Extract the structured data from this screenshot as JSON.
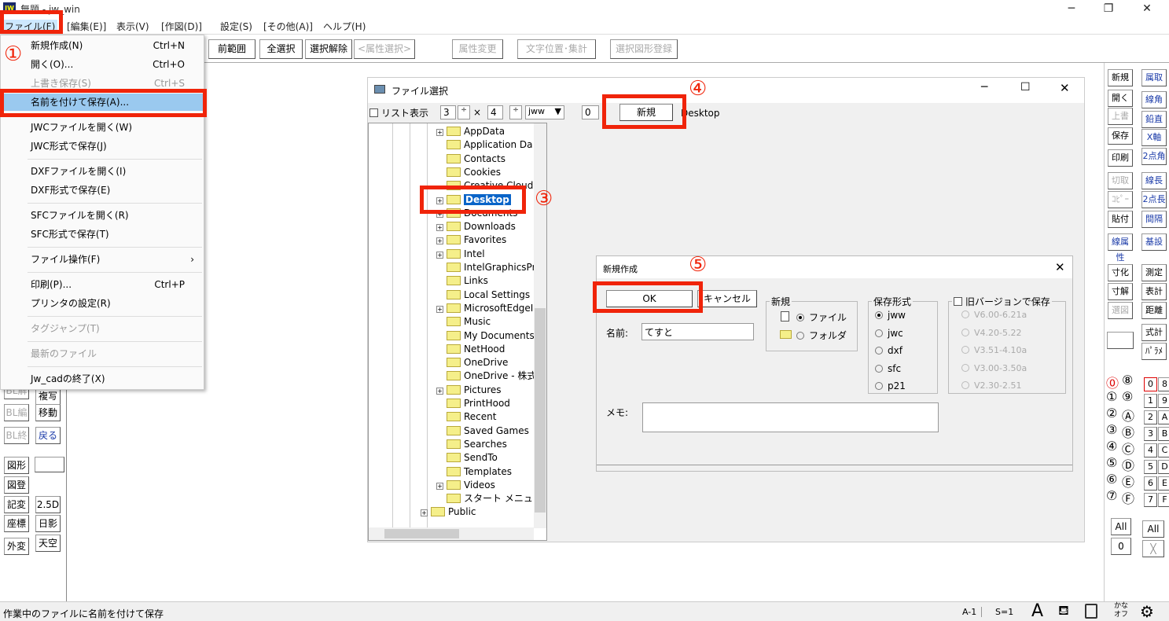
{
  "window": {
    "title": "無題 - jw_win",
    "icon": "JW",
    "minimize": "─",
    "restore": "❐",
    "close": "✕"
  },
  "menubar": [
    "ファイル(F)",
    "[編集(E)]",
    "表示(V)",
    "[作図(D)]",
    "設定(S)",
    "[その他(A)]",
    "ヘルプ(H)"
  ],
  "toolbar": [
    {
      "label": "前範囲",
      "disabled": false
    },
    {
      "label": "全選択",
      "disabled": false
    },
    {
      "label": "選択解除",
      "disabled": false
    },
    {
      "label": "<属性選択>",
      "disabled": true
    },
    {
      "label": "属性変更",
      "disabled": true
    },
    {
      "label": "文字位置･集計",
      "disabled": true
    },
    {
      "label": "選択図形登録",
      "disabled": true
    }
  ],
  "file_menu": [
    {
      "label": "新規作成(N)",
      "shortcut": "Ctrl+N"
    },
    {
      "label": "開く(O)...",
      "shortcut": "Ctrl+O"
    },
    {
      "label": "上書き保存(S)",
      "shortcut": "Ctrl+S",
      "disabled": true
    },
    {
      "label": "名前を付けて保存(A)...",
      "highlighted": true
    },
    {
      "label": "JWCファイルを開く(W)",
      "sep": true
    },
    {
      "label": "JWC形式で保存(J)"
    },
    {
      "label": "DXFファイルを開く(I)",
      "sep": true
    },
    {
      "label": "DXF形式で保存(E)"
    },
    {
      "label": "SFCファイルを開く(R)",
      "sep": true
    },
    {
      "label": "SFC形式で保存(T)"
    },
    {
      "label": "ファイル操作(F)",
      "submenu": true,
      "sep": true
    },
    {
      "label": "印刷(P)...",
      "shortcut": "Ctrl+P",
      "sep": true
    },
    {
      "label": "プリンタの設定(R)"
    },
    {
      "label": "タグジャンプ(T)",
      "disabled": true,
      "sep": true
    },
    {
      "label": "最新のファイル",
      "disabled": true,
      "sep": true
    },
    {
      "label": "Jw_cadの終了(X)",
      "sep": true
    }
  ],
  "left_toolbar": {
    "col1": [
      {
        "label": "BL解",
        "disabled": true
      },
      {
        "label": "BL編",
        "disabled": true
      },
      {
        "label": "BL終",
        "disabled": true
      },
      {
        "label": "図形"
      },
      {
        "label": "図登"
      },
      {
        "label": "記変"
      },
      {
        "label": "座標"
      },
      {
        "label": "外変"
      }
    ],
    "col2": [
      {
        "label": "複写"
      },
      {
        "label": "移動"
      },
      {
        "label": "戻る",
        "blue": true
      },
      {
        "label": "2.5D"
      },
      {
        "label": "日影"
      },
      {
        "label": "天空"
      }
    ]
  },
  "right_toolbar": {
    "col1": [
      {
        "label": "新規"
      },
      {
        "label": "開く"
      },
      {
        "label": "上書",
        "disabled": true
      },
      {
        "label": "保存"
      },
      {
        "label": "印刷"
      },
      {
        "label": "切取",
        "disabled": true
      },
      {
        "label": "ｺﾋﾟｰ",
        "disabled": true
      },
      {
        "label": "貼付"
      },
      {
        "label": "線属性",
        "blue": true
      },
      {
        "label": "寸化"
      },
      {
        "label": "寸解"
      },
      {
        "label": "選図",
        "disabled": true
      }
    ],
    "col2": [
      {
        "label": "属取",
        "blue": true
      },
      {
        "label": "線角",
        "blue": true
      },
      {
        "label": "鉛直",
        "blue": true
      },
      {
        "label": "X軸",
        "blue": true
      },
      {
        "label": "2点角",
        "blue": true
      },
      {
        "label": "線長",
        "blue": true
      },
      {
        "label": "2点長",
        "blue": true
      },
      {
        "label": "間隔",
        "blue": true
      },
      {
        "label": "基設",
        "blue": true
      },
      {
        "label": "測定"
      },
      {
        "label": "表計"
      },
      {
        "label": "距離"
      },
      {
        "label": "式計"
      },
      {
        "label": "ﾊﾟﾗﾒ"
      }
    ],
    "layer_groups": [
      "⓪",
      "⑧",
      "①",
      "⑨",
      "②",
      "Ⓐ",
      "③",
      "Ⓑ",
      "④",
      "Ⓒ",
      "⑤",
      "Ⓓ",
      "⑥",
      "Ⓔ",
      "⑦",
      "Ⓕ"
    ],
    "layers": [
      "0",
      "8",
      "1",
      "9",
      "2",
      "A",
      "3",
      "B",
      "4",
      "C",
      "5",
      "D",
      "6",
      "E",
      "7",
      "F"
    ],
    "all_label": "All",
    "zero_label": "0",
    "cross_label": "╳"
  },
  "file_dialog": {
    "title": "ファイル選択",
    "list_view_label": "リスト表示",
    "rows": "3",
    "cols": "4",
    "times": "×",
    "ext": "jww",
    "num": "0",
    "new_button": "新規",
    "path": "Desktop",
    "tree": [
      {
        "label": "AppData",
        "plus": true
      },
      {
        "label": "Application Da"
      },
      {
        "label": "Contacts"
      },
      {
        "label": "Cookies"
      },
      {
        "label": "Creative Cloud"
      },
      {
        "label": "Desktop",
        "plus": true,
        "selected": true
      },
      {
        "label": "Documents",
        "plus": true
      },
      {
        "label": "Downloads",
        "plus": true
      },
      {
        "label": "Favorites",
        "plus": true
      },
      {
        "label": "Intel",
        "plus": true
      },
      {
        "label": "IntelGraphicsPr"
      },
      {
        "label": "Links"
      },
      {
        "label": "Local Settings"
      },
      {
        "label": "MicrosoftEdgeI",
        "plus": true
      },
      {
        "label": "Music"
      },
      {
        "label": "My Documents"
      },
      {
        "label": "NetHood"
      },
      {
        "label": "OneDrive"
      },
      {
        "label": "OneDrive - 株式"
      },
      {
        "label": "Pictures",
        "plus": true
      },
      {
        "label": "PrintHood"
      },
      {
        "label": "Recent"
      },
      {
        "label": "Saved Games"
      },
      {
        "label": "Searches"
      },
      {
        "label": "SendTo"
      },
      {
        "label": "Templates"
      },
      {
        "label": "Videos",
        "plus": true
      },
      {
        "label": "スタート メニュ"
      },
      {
        "label": "Public",
        "plus": true,
        "level": 0
      }
    ]
  },
  "new_dialog": {
    "title": "新規作成",
    "ok": "OK",
    "cancel": "キャンセル",
    "new_group": "新規",
    "file": "ファイル",
    "folder": "フォルダ",
    "format_group": "保存形式",
    "formats": [
      "jww",
      "jwc",
      "dxf",
      "sfc",
      "p21"
    ],
    "selected_format": "jww",
    "old_version_label": "旧バージョンで保存",
    "versions": [
      "V6.00-6.21a",
      "V4.20-5.22",
      "V3.51-4.10a",
      "V3.00-3.50a",
      "V2.30-2.51"
    ],
    "name_label": "名前:",
    "name_value": "てすと",
    "memo_label": "メモ:",
    "memo_value": ""
  },
  "annotations": [
    "①",
    "③",
    "④",
    "⑤"
  ],
  "statusbar": {
    "text": "作業中のファイルに名前を付けて保存",
    "paper": "A-1",
    "scale": "S=1",
    "ime": [
      "かな",
      "オフ"
    ]
  },
  "colors": {
    "annotation": "#f0240a",
    "highlight": "#9ac9ef",
    "selected": "#0a64c8"
  }
}
